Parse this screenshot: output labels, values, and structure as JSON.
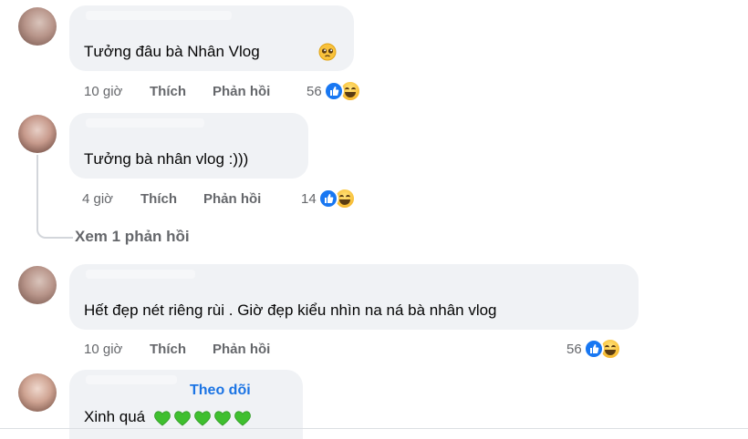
{
  "comments": [
    {
      "text": "Tưởng đâu bà Nhân Vlog",
      "time": "10 giờ",
      "like_label": "Thích",
      "reply_label": "Phản hồi",
      "reaction_count": "56"
    },
    {
      "text": "Tưởng bà nhân vlog :)))",
      "time": "4 giờ",
      "like_label": "Thích",
      "reply_label": "Phản hồi",
      "reaction_count": "14",
      "replies_link": "Xem 1 phản hồi"
    },
    {
      "text": "Hết đẹp nét riêng rùi . Giờ đẹp kiểu nhìn na ná bà nhân vlog",
      "time": "10 giờ",
      "like_label": "Thích",
      "reply_label": "Phản hồi",
      "reaction_count": "56"
    },
    {
      "follow_label": "Theo dõi",
      "text": "Xinh quá"
    }
  ],
  "colors": {
    "bubble": "#f0f2f5",
    "meta_text": "#65676b",
    "like_blue": "#1877f2",
    "follow_blue": "#1b74e4",
    "heart_green": "#3fbf2f"
  },
  "icons": [
    "like-reaction-icon",
    "haha-reaction-icon",
    "pleading-face-emoji-icon",
    "green-heart-emoji-icon"
  ]
}
